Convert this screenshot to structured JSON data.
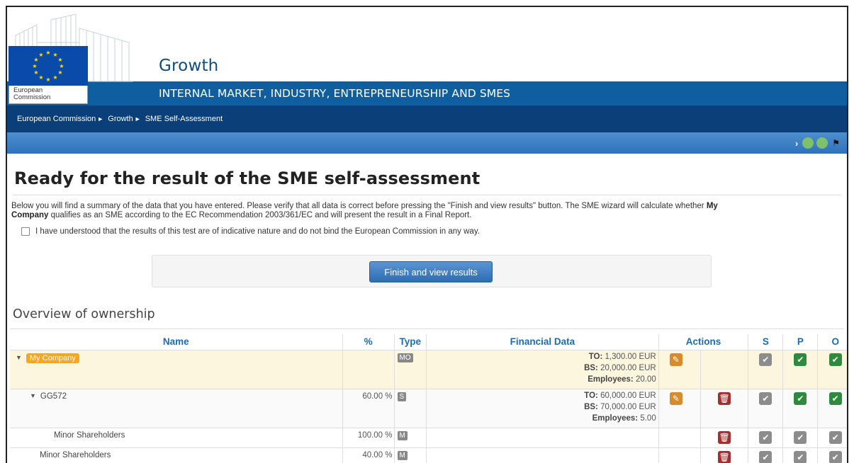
{
  "header": {
    "logo_text_line1": "European",
    "logo_text_line2": "Commission",
    "site_name": "Growth",
    "dg_name": "INTERNAL MARKET, INDUSTRY, ENTREPRENEURSHIP AND SMES",
    "breadcrumb": [
      "European Commission",
      "Growth",
      "SME Self-Assessment"
    ],
    "toolbar_icons": [
      "chevron-right-icon",
      "green-circle-icon",
      "green-circle-icon",
      "flag-icon"
    ]
  },
  "page": {
    "title": "Ready for the result of the SME self-assessment",
    "intro_part1": "Below you will find a summary of the data that you have entered. Please verify that all data is correct before pressing the \"Finish and view results\" button. The SME wizard will calculate whether ",
    "intro_bold1": "My",
    "intro_bold2": "Company",
    "intro_part2": " qualifies as an SME according to the EC Recommendation 2003/361/EC and will present the result in a Final Report.",
    "understand_label": "I have understood that the results of this test are of indicative nature and do not bind the European Commission in any way.",
    "understand_checked": false,
    "finish_button": "Finish and view results",
    "overview_title": "Overview of ownership"
  },
  "table": {
    "columns": [
      "Name",
      "%",
      "Type",
      "Financial Data",
      "Actions",
      "S",
      "P",
      "O"
    ],
    "rows": [
      {
        "name": "My Company",
        "percent": "",
        "type": "MO",
        "fin_to_label": "TO:",
        "fin_to_value": "1,300.00 EUR",
        "fin_bs_label": "BS:",
        "fin_bs_value": "20,000.00 EUR",
        "fin_emp_label": "Employees:",
        "fin_emp_value": "20.00",
        "s": "grey",
        "p": "green",
        "o": "green"
      },
      {
        "name": "GG572",
        "percent": "60.00 %",
        "type": "S",
        "fin_to_label": "TO:",
        "fin_to_value": "60,000.00 EUR",
        "fin_bs_label": "BS:",
        "fin_bs_value": "70,000.00 EUR",
        "fin_emp_label": "Employees:",
        "fin_emp_value": "5.00",
        "s": "grey",
        "p": "green",
        "o": "green"
      },
      {
        "name": "Minor Shareholders",
        "percent": "100.00 %",
        "type": "M",
        "s": "grey",
        "p": "grey",
        "o": "grey"
      },
      {
        "name": "Minor Shareholders",
        "percent": "40.00 %",
        "type": "M",
        "s": "grey",
        "p": "grey",
        "o": "grey"
      }
    ]
  },
  "colors": {
    "dg_bar": "#0f5fa0",
    "breadcrumb_bar": "#0a3f7a",
    "header_text": "#1b6bb8",
    "company_badge": "#f5a623",
    "edit_button": "#d98a2b",
    "delete_button": "#a3302f",
    "check_green": "#2e8b3d",
    "check_grey": "#8c8c8c"
  }
}
